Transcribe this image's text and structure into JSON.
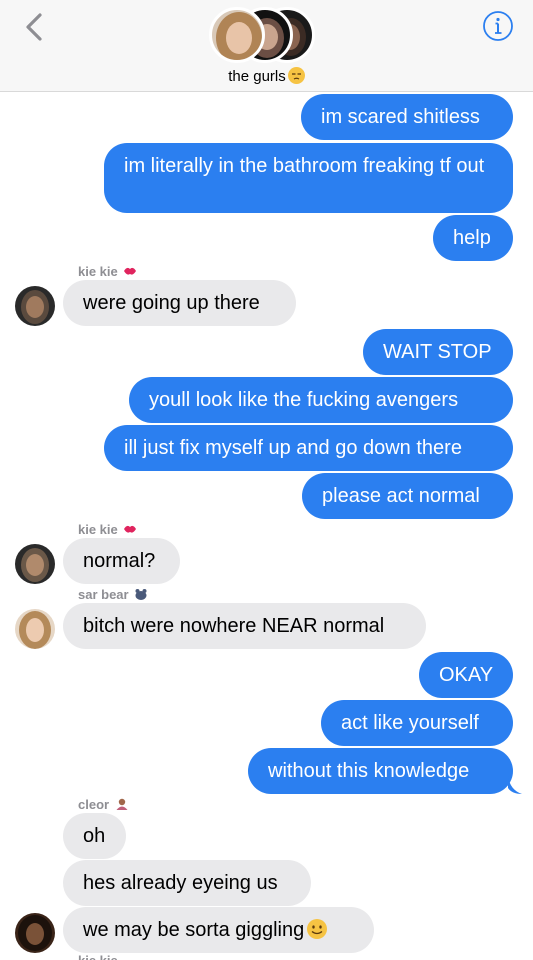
{
  "header": {
    "group_name": "the gurls",
    "group_name_emoji": "unamused-face-emoji",
    "back_icon": "chevron-left-icon",
    "info_icon": "info-circle-icon"
  },
  "colors": {
    "outgoing_bubble": "#2b7ff0",
    "incoming_bubble": "#e9e9eb",
    "sender_label": "#8e8e93",
    "accent": "#2b7ff0"
  },
  "messages": [
    {
      "dir": "out",
      "text": "im scared shitless"
    },
    {
      "dir": "out",
      "text": "im literally in the bathroom freaking tf out"
    },
    {
      "dir": "out",
      "text": "help"
    },
    {
      "dir": "in",
      "sender": "kie kie",
      "sender_emoji": "kiss-mark-emoji",
      "text": "were going up there"
    },
    {
      "dir": "out",
      "text": "WAIT STOP"
    },
    {
      "dir": "out",
      "text": "youll look like the fucking avengers"
    },
    {
      "dir": "out",
      "text": "ill just fix myself up and go down there"
    },
    {
      "dir": "out",
      "text": "please act normal"
    },
    {
      "dir": "in",
      "sender": "kie kie",
      "sender_emoji": "kiss-mark-emoji",
      "text": "normal?"
    },
    {
      "dir": "in",
      "sender": "sar bear",
      "sender_emoji": "bear-emoji",
      "text": "bitch were nowhere NEAR normal"
    },
    {
      "dir": "out",
      "text": "OKAY"
    },
    {
      "dir": "out",
      "text": "act like yourself"
    },
    {
      "dir": "out",
      "text": "without this knowledge"
    },
    {
      "dir": "in",
      "sender": "cleor",
      "sender_emoji": "person-emoji",
      "text": "oh"
    },
    {
      "dir": "in",
      "text": "hes already eyeing us"
    },
    {
      "dir": "in",
      "text": "we may be sorta giggling",
      "trailing_emoji": "smiling-face-emoji"
    }
  ]
}
